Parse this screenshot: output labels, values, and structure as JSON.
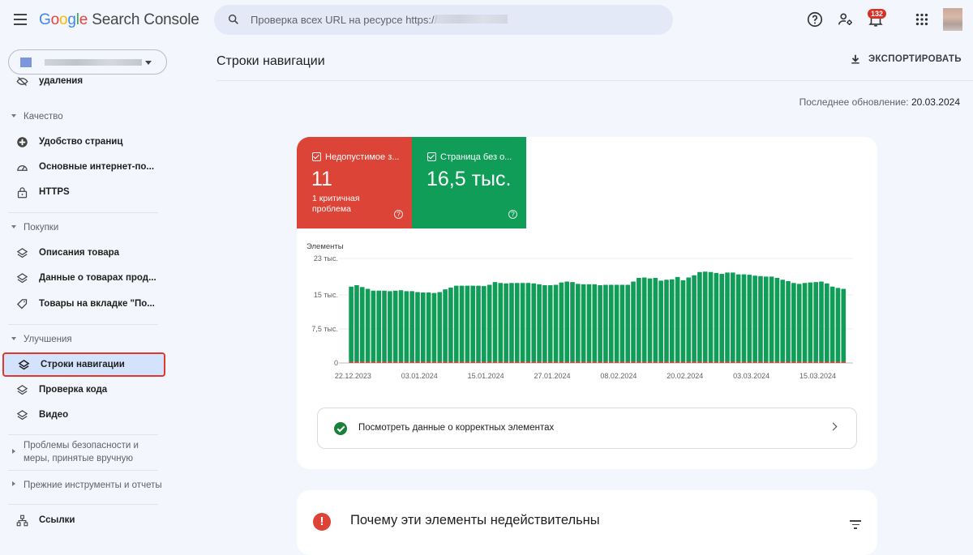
{
  "app": {
    "logo_google": [
      "G",
      "o",
      "o",
      "g",
      "l",
      "e"
    ],
    "logo_rest": "Search Console"
  },
  "search": {
    "placeholder": "Проверка всех URL на ресурсе https://"
  },
  "topbar": {
    "icons": [
      "help-icon",
      "manage-users-icon",
      "notifications-icon",
      "apps-grid-icon",
      "account-avatar"
    ],
    "notifications_count": "132"
  },
  "sidebar": {
    "property_selector": {
      "value": ""
    },
    "items": [
      {
        "type": "item",
        "label": "удаления",
        "icon": "removals-icon"
      },
      {
        "type": "section",
        "label": "Качество",
        "expanded": true
      },
      {
        "type": "item",
        "label": "Удобство страниц",
        "icon": "page-experience-icon"
      },
      {
        "type": "item",
        "label": "Основные интернет-по...",
        "icon": "speed-gauge-icon"
      },
      {
        "type": "item",
        "label": "HTTPS",
        "icon": "lock-icon"
      },
      {
        "type": "section",
        "label": "Покупки",
        "expanded": true
      },
      {
        "type": "item",
        "label": "Описания товара",
        "icon": "layers-icon"
      },
      {
        "type": "item",
        "label": "Данные о товарах прод...",
        "icon": "layers-icon"
      },
      {
        "type": "item",
        "label": "Товары на вкладке \"По...",
        "icon": "tag-icon"
      },
      {
        "type": "section",
        "label": "Улучшения",
        "expanded": true
      },
      {
        "type": "item",
        "label": "Строки навигации",
        "icon": "layers-icon",
        "active": true
      },
      {
        "type": "item",
        "label": "Проверка кода",
        "icon": "layers-icon"
      },
      {
        "type": "item",
        "label": "Видео",
        "icon": "layers-icon"
      },
      {
        "type": "section",
        "label": "Проблемы безопасности и меры, принятые вручную",
        "expanded": false
      },
      {
        "type": "section",
        "label": "Прежние инструменты и отчеты",
        "expanded": false
      },
      {
        "type": "item",
        "label": "Ссылки",
        "icon": "links-icon"
      }
    ]
  },
  "main": {
    "page_title": "Строки навигации",
    "export_label": "ЭКСПОРТИРОВАТЬ",
    "last_update_label": "Последнее обновление:",
    "last_update_value": "20.03.2024",
    "tiles": [
      {
        "label": "Недопустимое з...",
        "value": "11",
        "sub": "1 критичная проблема",
        "color": "#db4437",
        "checked": true
      },
      {
        "label": "Страница без о...",
        "value": "16,5 тыс.",
        "sub": "",
        "color": "#0f9d58",
        "checked": true
      }
    ],
    "valid_link_label": "Посмотреть данные о корректных элементах",
    "issues_title": "Почему эти элементы недействительны"
  },
  "chart_data": {
    "type": "bar",
    "title": "",
    "ylabel": "Элементы",
    "xlabel": "",
    "ylim": [
      0,
      23000
    ],
    "yticks": [
      0,
      7500,
      15000,
      23000
    ],
    "ytick_labels": [
      "0",
      "7,5 тыс.",
      "15 тыс.",
      "23 тыс."
    ],
    "xtick_labels": [
      "22.12.2023",
      "03.01.2024",
      "15.01.2024",
      "27.01.2024",
      "08.02.2024",
      "20.02.2024",
      "03.03.2024",
      "15.03.2024"
    ],
    "xtick_index": [
      0,
      12,
      24,
      36,
      48,
      60,
      72,
      84
    ],
    "grid": true,
    "legend": "none",
    "series": [
      {
        "name": "Недопустимое значение",
        "color": "#db4437",
        "values": [
          11,
          11,
          11,
          11,
          11,
          11,
          11,
          11,
          11,
          11,
          11,
          11,
          11,
          11,
          11,
          11,
          11,
          11,
          11,
          11,
          11,
          11,
          11,
          11,
          11,
          11,
          11,
          11,
          11,
          11,
          11,
          11,
          11,
          11,
          11,
          11,
          11,
          11,
          11,
          11,
          11,
          11,
          11,
          11,
          11,
          11,
          11,
          11,
          11,
          11,
          11,
          11,
          11,
          11,
          11,
          11,
          11,
          11,
          11,
          11,
          11,
          11,
          11,
          11,
          11,
          11,
          11,
          11,
          11,
          11,
          11,
          11,
          11,
          11,
          11,
          11,
          11,
          11,
          11,
          11,
          11,
          11,
          11,
          11,
          11,
          11,
          11,
          11,
          11,
          11
        ]
      },
      {
        "name": "Страница без ошибок",
        "color": "#0f9d58",
        "values": [
          16800,
          17100,
          16700,
          16300,
          15900,
          15900,
          15900,
          15800,
          15900,
          16000,
          15800,
          15800,
          15600,
          15500,
          15500,
          15400,
          15600,
          16200,
          16600,
          17000,
          17000,
          17000,
          17000,
          17000,
          16900,
          17200,
          17800,
          17600,
          17500,
          17600,
          17600,
          17600,
          17600,
          17500,
          17300,
          17100,
          17100,
          17200,
          17700,
          17900,
          17800,
          17400,
          17300,
          17300,
          17300,
          17100,
          17200,
          17200,
          17200,
          17200,
          17200,
          17900,
          18700,
          18800,
          18600,
          18700,
          18100,
          18300,
          18400,
          18900,
          18200,
          18800,
          19300,
          20000,
          20100,
          20000,
          19800,
          19600,
          19900,
          19900,
          19500,
          19500,
          19400,
          19200,
          19100,
          19000,
          19000,
          18700,
          18300,
          18000,
          17600,
          17400,
          17600,
          17700,
          17800,
          17900,
          17500,
          16800,
          16500,
          16300
        ]
      }
    ]
  }
}
